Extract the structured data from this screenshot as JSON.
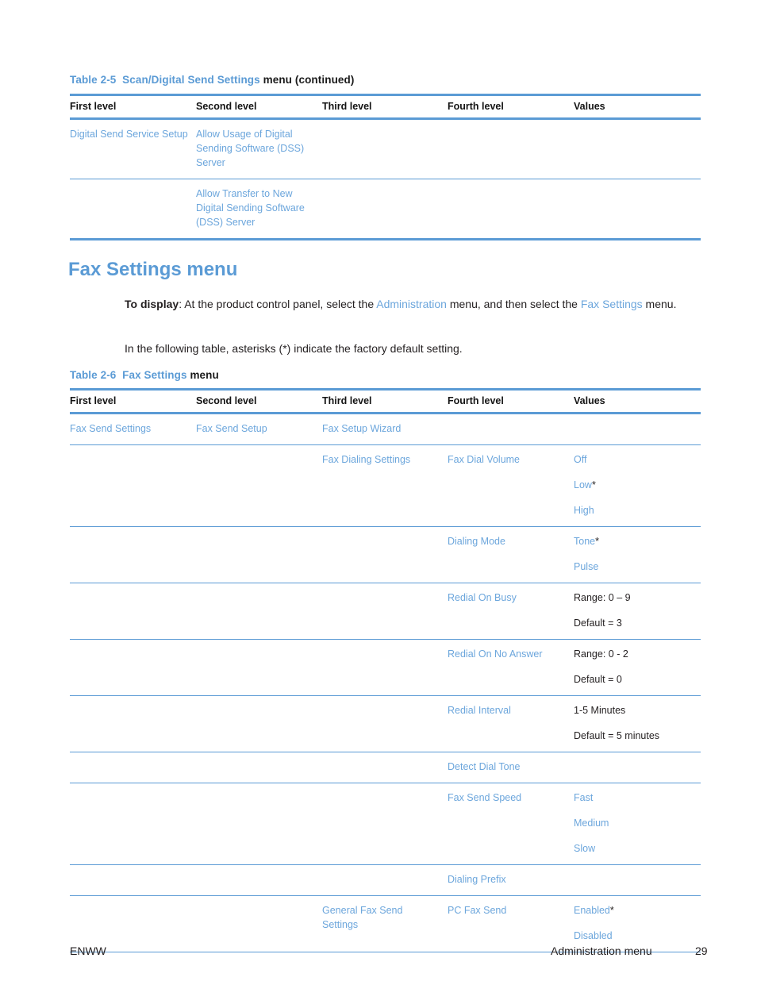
{
  "table_a": {
    "caption_prefix": "Table 2-5",
    "caption_blue": "Scan/Digital Send Settings",
    "caption_dark": "menu (continued)",
    "headers": [
      "First level",
      "Second level",
      "Third level",
      "Fourth level",
      "Values"
    ],
    "rows": [
      {
        "first": "Digital Send Service Setup",
        "second": "Allow Usage of Digital Sending Software (DSS) Server",
        "third": "",
        "fourth": "",
        "values": []
      },
      {
        "first": "",
        "second": "Allow Transfer to New Digital Sending Software (DSS) Server",
        "third": "",
        "fourth": "",
        "values": []
      }
    ]
  },
  "section": {
    "heading": "Fax Settings menu",
    "para1": {
      "lead": "To display",
      "seg1": ": At the product control panel, select the ",
      "link1": "Administration",
      "seg2": " menu, and then select the ",
      "link2": "Fax Settings",
      "seg3": " menu."
    },
    "para2": "In the following table, asterisks (*) indicate the factory default setting."
  },
  "table_b": {
    "caption_prefix": "Table 2-6",
    "caption_blue": "Fax Settings",
    "caption_dark": "menu",
    "headers": [
      "First level",
      "Second level",
      "Third level",
      "Fourth level",
      "Values"
    ],
    "rows": [
      {
        "first": "Fax Send Settings",
        "second": "Fax Send Setup",
        "third": "Fax Setup Wizard",
        "fourth": "",
        "values": [],
        "values_dark": false
      },
      {
        "first": "",
        "second": "",
        "third": "Fax Dialing Settings",
        "fourth": "Fax Dial Volume",
        "values": [
          "Off",
          "Low*",
          "High"
        ],
        "values_dark": false
      },
      {
        "first": "",
        "second": "",
        "third": "",
        "fourth": "Dialing Mode",
        "values": [
          "Tone*",
          "Pulse"
        ],
        "values_dark": false
      },
      {
        "first": "",
        "second": "",
        "third": "",
        "fourth": "Redial On Busy",
        "values": [
          "Range: 0 – 9",
          "Default = 3"
        ],
        "values_dark": true
      },
      {
        "first": "",
        "second": "",
        "third": "",
        "fourth": "Redial On No Answer",
        "values": [
          "Range: 0 - 2",
          "Default = 0"
        ],
        "values_dark": true
      },
      {
        "first": "",
        "second": "",
        "third": "",
        "fourth": "Redial Interval",
        "values": [
          "1-5 Minutes",
          "Default = 5 minutes"
        ],
        "values_dark": true
      },
      {
        "first": "",
        "second": "",
        "third": "",
        "fourth": "Detect Dial Tone",
        "values": [],
        "values_dark": false
      },
      {
        "first": "",
        "second": "",
        "third": "",
        "fourth": "Fax Send Speed",
        "values": [
          "Fast",
          "Medium",
          "Slow"
        ],
        "values_dark": false
      },
      {
        "first": "",
        "second": "",
        "third": "",
        "fourth": "Dialing Prefix",
        "values": [],
        "values_dark": false
      },
      {
        "first": "",
        "second": "",
        "third": "General Fax Send Settings",
        "fourth": "PC Fax Send",
        "values": [
          "Enabled*",
          "Disabled"
        ],
        "values_dark": false
      }
    ]
  },
  "footer": {
    "left": "ENWW",
    "right": "Administration menu",
    "page": "29"
  }
}
